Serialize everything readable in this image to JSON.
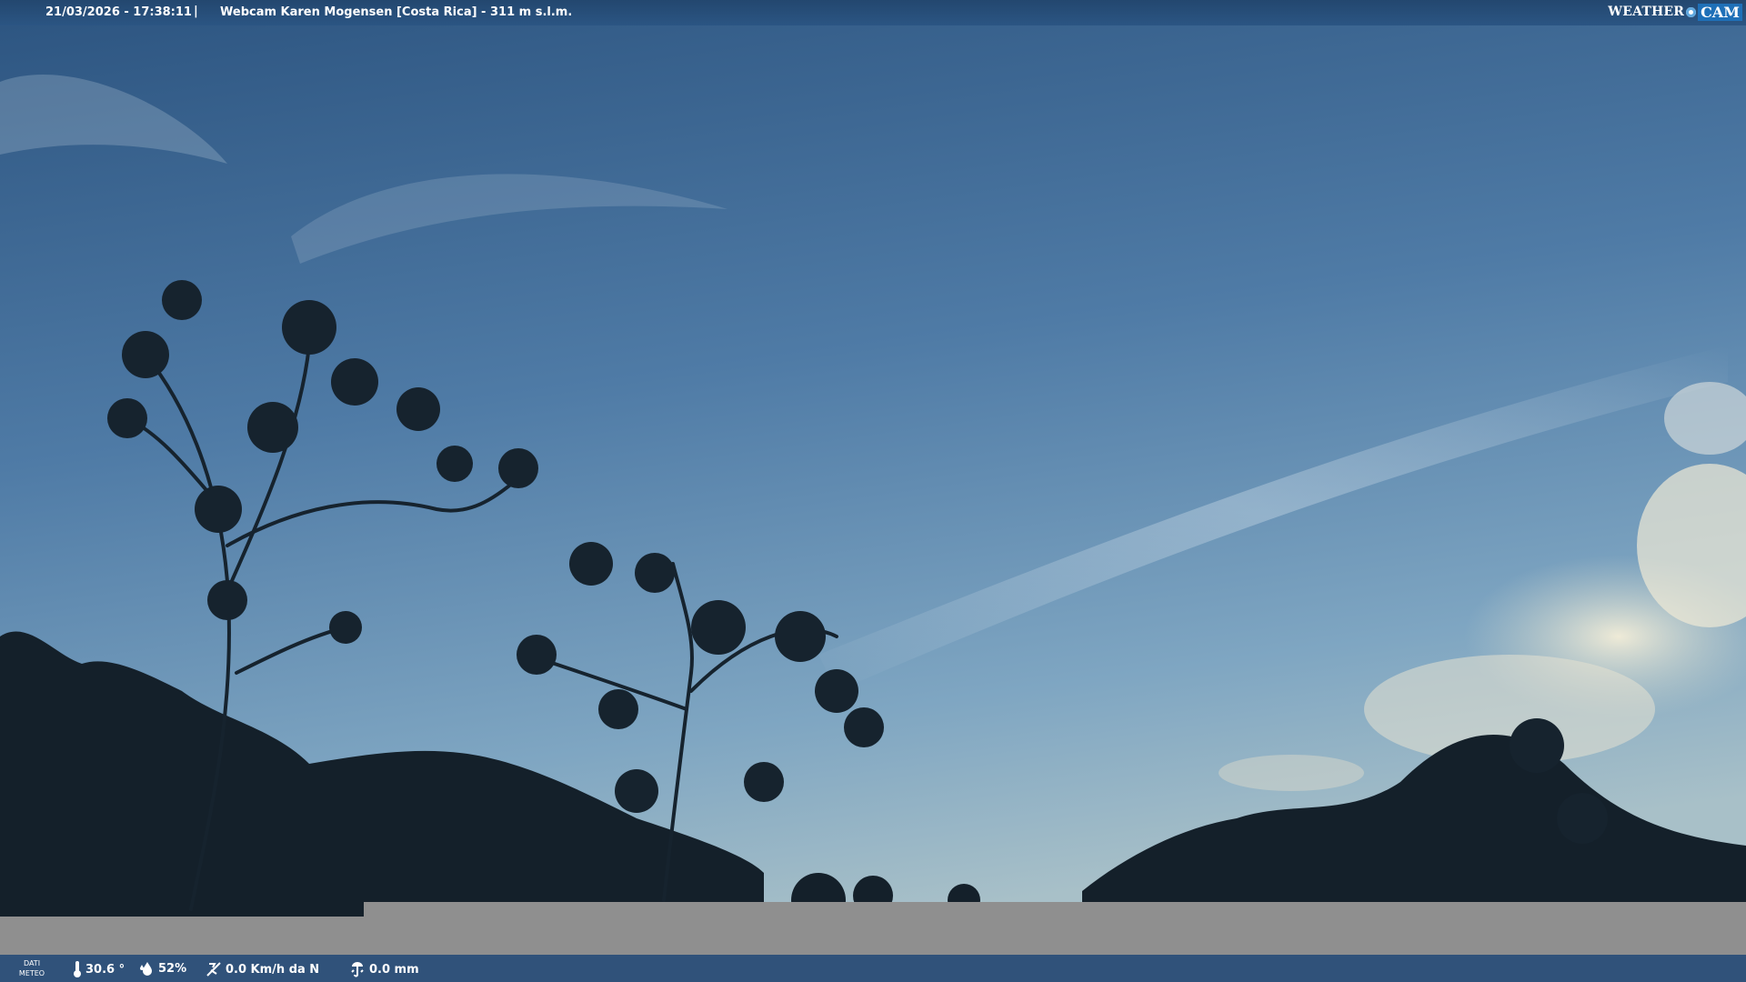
{
  "header": {
    "timestamp": "21/03/2026 - 17:38:11",
    "separator": "|",
    "camera_title": "Webcam Karen Mogensen [Costa Rica]  - 311 m s.l.m."
  },
  "logo": {
    "word1": "WEATHER",
    "word2": "CAM"
  },
  "footer": {
    "dati_label_line1": "DATI",
    "dati_label_line2": "METEO",
    "temperature": "30.6 °",
    "humidity": "52%",
    "wind": "0.0 Km/h da N",
    "rain": "0.0 mm"
  },
  "colors": {
    "top_bar": "#23476f",
    "bottom_bar": "#30527a",
    "gray_band": "#8f8f8f",
    "sky_top": "#2f5a86",
    "sky_bottom": "#8fb4c8"
  },
  "icons": [
    "thermometer-icon",
    "humidity-icon",
    "wind-icon",
    "rain-gauge-icon"
  ]
}
